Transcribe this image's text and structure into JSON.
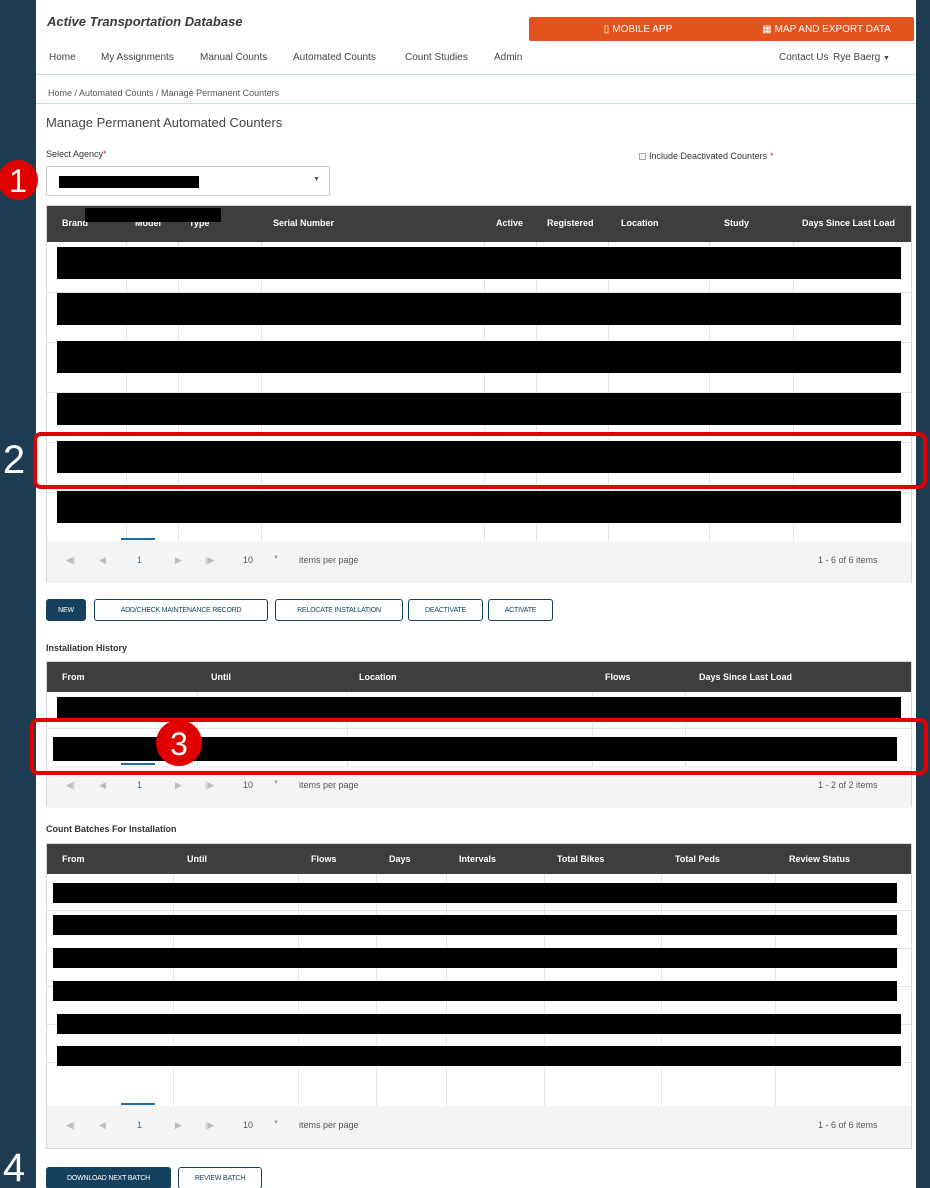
{
  "app": {
    "title": "Active Transportation Database"
  },
  "header_buttons": {
    "mobile_app": "MOBILE APP",
    "map_export": "MAP AND EXPORT DATA"
  },
  "nav": {
    "items": [
      "Home",
      "My Assignments",
      "Manual Counts",
      "Automated Counts",
      "Count Studies",
      "Admin"
    ],
    "contact": "Contact Us",
    "user": "Rye Baerg"
  },
  "breadcrumb": "Home / Automated Counts / Manage Permanent Counters",
  "page_title": "Manage Permanent Automated Counters",
  "agency": {
    "label": "Select Agency",
    "required_mark": "*"
  },
  "include_deactivated": {
    "label": "Include Deactivated Counters",
    "required_mark": "*"
  },
  "counters_grid": {
    "columns": [
      "Brand",
      "Model",
      "Type",
      "Serial Number",
      "Active",
      "Registered",
      "Location",
      "Study",
      "Days Since Last Load"
    ],
    "pager": {
      "page": "1",
      "page_size": "10",
      "items_label": "items per page",
      "summary": "1 - 6 of 6 items"
    }
  },
  "actions": {
    "new": "NEW",
    "maintenance": "ADD/CHECK MAINTENANCE RECORD",
    "relocate": "RELOCATE INSTALLATION",
    "deactivate": "DEACTIVATE",
    "activate": "ACTIVATE"
  },
  "installation_history": {
    "title": "Installation History",
    "columns": [
      "From",
      "Until",
      "Location",
      "Flows",
      "Days Since Last Load"
    ],
    "pager": {
      "page": "1",
      "page_size": "10",
      "items_label": "items per page",
      "summary": "1 - 2 of 2 items"
    }
  },
  "count_batches": {
    "title": "Count Batches For Installation",
    "columns": [
      "From",
      "Until",
      "Flows",
      "Days",
      "Intervals",
      "Total Bikes",
      "Total Peds",
      "Review Status"
    ],
    "pager": {
      "page": "1",
      "page_size": "10",
      "items_label": "items per page",
      "summary": "1 - 6 of 6 items"
    }
  },
  "batch_actions": {
    "download": "DOWNLOAD NEXT BATCH",
    "review": "REVIEW BATCH"
  },
  "markers": [
    "1",
    "2",
    "3",
    "4"
  ],
  "colors": {
    "accent_orange": "#e2531d",
    "primary": "#15415e",
    "annotation_red": "#e00000",
    "header_dark": "#3e3e3e",
    "background": "#1d3c52"
  }
}
